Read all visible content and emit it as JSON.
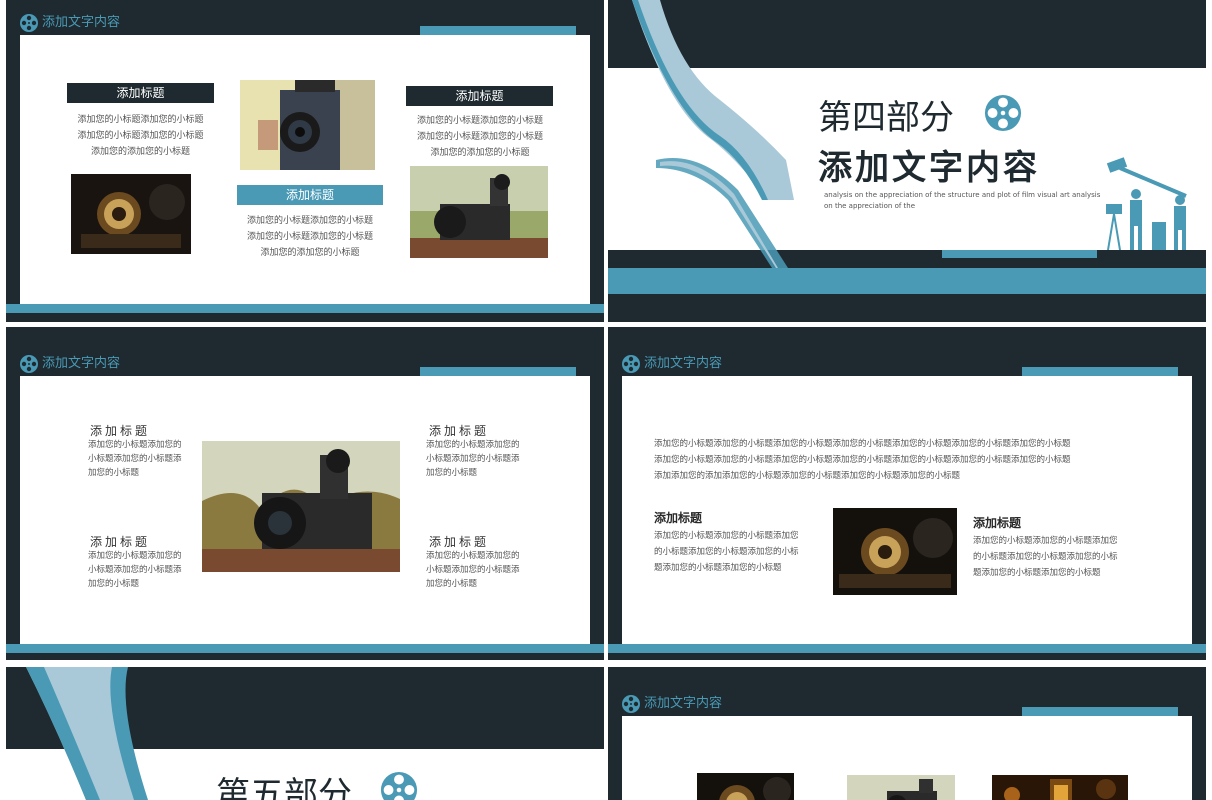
{
  "colors": {
    "dark": "#1e2a30",
    "accent": "#4a9ab6",
    "panel": "#ffffff",
    "body_text": "#555555"
  },
  "header": {
    "icon": "film-reel-icon",
    "text": "添加文字内容"
  },
  "slide1": {
    "label_left": "添加标题",
    "text_left": "添加您的小标题添加您的小标题\n添加您的小标题添加您的小标题\n添加您的添加您的小标题",
    "label_center": "添加标题",
    "text_center": "添加您的小标题添加您的小标题\n添加您的小标题添加您的小标题\n添加您的添加您的小标题",
    "label_right": "添加标题",
    "text_right": "添加您的小标题添加您的小标题\n添加您的小标题添加您的小标题\n添加您的添加您的小标题"
  },
  "slide2": {
    "part": "第四部分",
    "title": "添加文字内容",
    "english": "analysis on the appreciation of the structure and plot of film visual art analysis\non the appreciation of the"
  },
  "slide3": {
    "top_left_title": "添加标题",
    "top_left_text": "添加您的小标题添加您的\n小标题添加您的小标题添\n加您的小标题",
    "bottom_left_title": "添加标题",
    "bottom_left_text": "添加您的小标题添加您的\n小标题添加您的小标题添\n加您的小标题",
    "top_right_title": "添加标题",
    "top_right_text": "添加您的小标题添加您的\n小标题添加您的小标题添\n加您的小标题",
    "bottom_right_title": "添加标题",
    "bottom_right_text": "添加您的小标题添加您的\n小标题添加您的小标题添\n加您的小标题"
  },
  "slide4": {
    "paragraph": "添加您的小标题添加您的小标题添加您的小标题添加您的小标题添加您的小标题添加您的小标题添加您的小标题\n添加您的小标题添加您的小标题添加您的小标题添加您的小标题添加您的小标题添加您的小标题添加您的小标题\n添加添加您的添加添加您的小标题添加您的小标题添加您的小标题添加您的小标题",
    "left_title": "添加标题",
    "left_text": "添加您的小标题添加您的小标题添加您\n的小标题添加您的小标题添加您的小标\n题添加您的小标题添加您的小标题",
    "right_title": "添加标题",
    "right_text": "添加您的小标题添加您的小标题添加您\n的小标题添加您的小标题添加您的小标\n题添加您的小标题添加您的小标题"
  },
  "slide5": {
    "part": "第五部分"
  }
}
